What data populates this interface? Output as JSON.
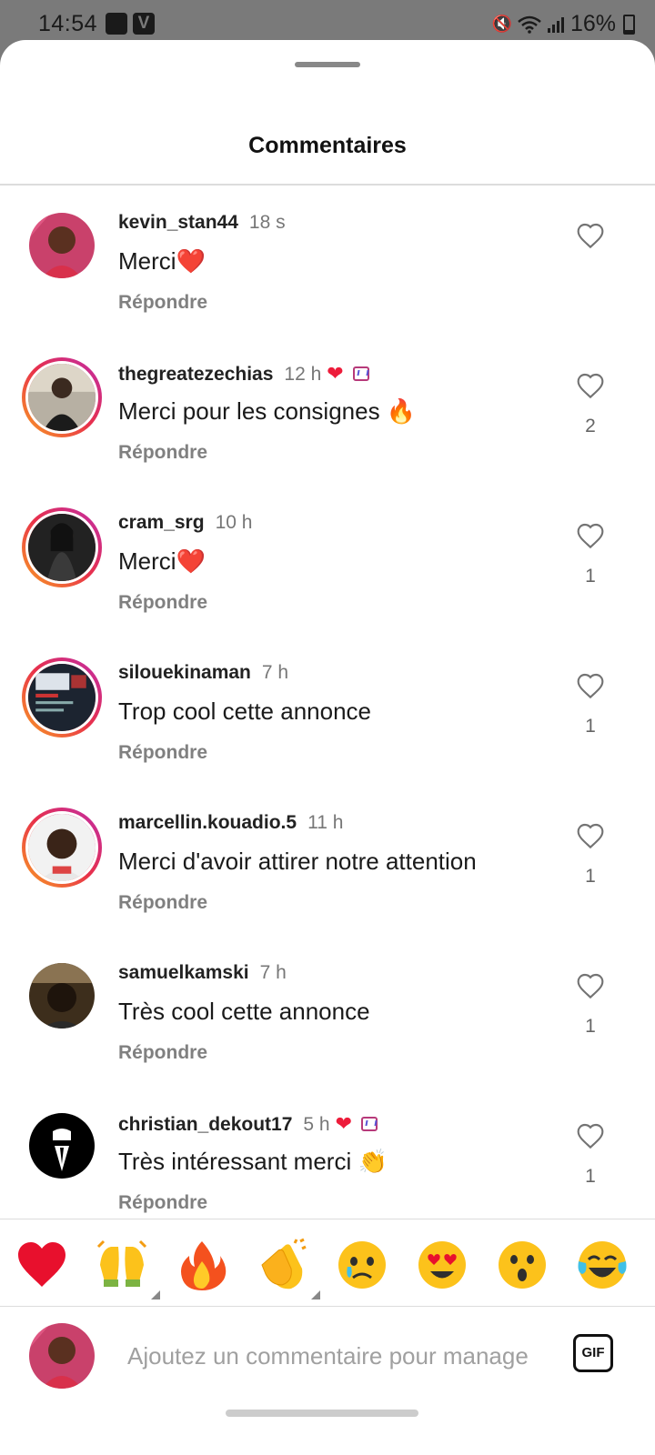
{
  "status_bar": {
    "time": "14:54",
    "battery": "16%",
    "app_badge": "V"
  },
  "sheet": {
    "title": "Commentaires"
  },
  "comments": [
    {
      "username": "kevin_stan44",
      "time": "18 s",
      "text": "Merci",
      "emoji": "❤️",
      "reply": "Répondre",
      "likes": "",
      "ring": false,
      "creator_liked": false
    },
    {
      "username": "thegreatezechias",
      "time": "12 h",
      "text": "Merci pour les consignes ",
      "emoji": "🔥",
      "reply": "Répondre",
      "likes": "2",
      "ring": true,
      "creator_liked": true
    },
    {
      "username": "cram_srg",
      "time": "10 h",
      "text": "Merci",
      "emoji": "❤️",
      "reply": "Répondre",
      "likes": "1",
      "ring": true,
      "creator_liked": false
    },
    {
      "username": "silouekinaman",
      "time": "7 h",
      "text": "Trop cool cette annonce",
      "emoji": "",
      "reply": "Répondre",
      "likes": "1",
      "ring": true,
      "creator_liked": false
    },
    {
      "username": "marcellin.kouadio.5",
      "time": "11 h",
      "text": "Merci d'avoir attirer notre attention",
      "emoji": "",
      "reply": "Répondre",
      "likes": "1",
      "ring": true,
      "creator_liked": false
    },
    {
      "username": "samuelkamski",
      "time": "7 h",
      "text": "Très cool cette annonce",
      "emoji": "",
      "reply": "Répondre",
      "likes": "1",
      "ring": false,
      "creator_liked": false
    },
    {
      "username": "christian_dekout17",
      "time": "5 h",
      "text": "Très intéressant merci ",
      "emoji": "👏",
      "reply": "Répondre",
      "likes": "1",
      "ring": false,
      "creator_liked": true
    }
  ],
  "creator_heart": "❤",
  "emoji_bar": [
    {
      "icon": "red-heart"
    },
    {
      "icon": "raising-hands",
      "has_variants": true
    },
    {
      "icon": "fire"
    },
    {
      "icon": "clapping-hands",
      "has_variants": true
    },
    {
      "icon": "crying-face"
    },
    {
      "icon": "heart-eyes-face"
    },
    {
      "icon": "surprised-face"
    },
    {
      "icon": "tears-of-joy-face"
    }
  ],
  "composer": {
    "placeholder": "Ajoutez un commentaire pour manage",
    "gif_label": "GIF"
  },
  "colors": {
    "accent_heart": "#ed1c3a",
    "story_ring_start": "#f9a023",
    "story_ring_end": "#c02ca9"
  }
}
